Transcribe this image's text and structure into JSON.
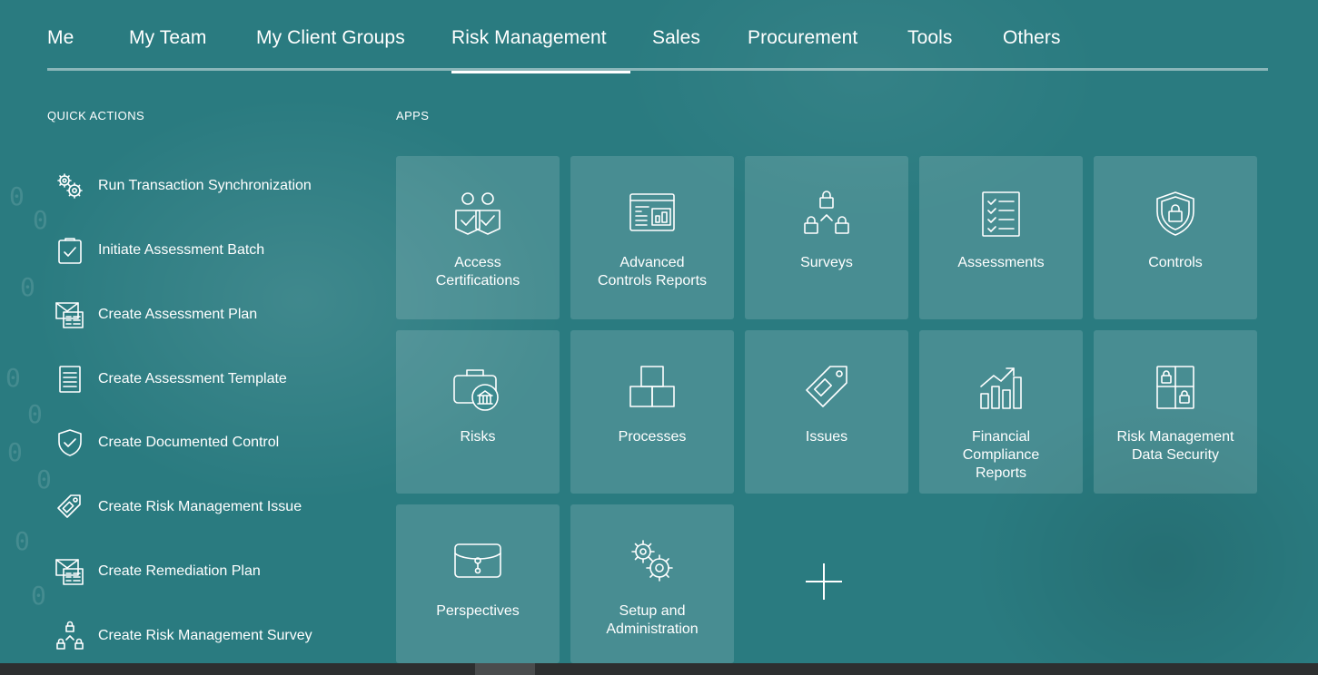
{
  "nav": {
    "tabs": [
      {
        "label": "Me"
      },
      {
        "label": "My Team"
      },
      {
        "label": "My Client Groups"
      },
      {
        "label": "Risk Management",
        "active": true
      },
      {
        "label": "Sales"
      },
      {
        "label": "Procurement"
      },
      {
        "label": "Tools"
      },
      {
        "label": "Others"
      }
    ]
  },
  "quick_actions": {
    "heading": "QUICK ACTIONS",
    "items": [
      {
        "label": "Run Transaction Synchronization",
        "icon": "gears-icon"
      },
      {
        "label": "Initiate Assessment Batch",
        "icon": "clipboard-check-icon"
      },
      {
        "label": "Create Assessment Plan",
        "icon": "envelope-form-icon"
      },
      {
        "label": "Create Assessment Template",
        "icon": "document-lines-icon"
      },
      {
        "label": "Create Documented Control",
        "icon": "shield-check-icon"
      },
      {
        "label": "Create Risk Management Issue",
        "icon": "tag-icon"
      },
      {
        "label": "Create Remediation Plan",
        "icon": "envelope-form-icon"
      },
      {
        "label": "Create Risk Management Survey",
        "icon": "lock-hierarchy-icon"
      }
    ]
  },
  "apps": {
    "heading": "APPS",
    "tiles": [
      {
        "label_lines": [
          "Access",
          "Certifications"
        ],
        "icon": "people-check-icon"
      },
      {
        "label_lines": [
          "Advanced",
          "Controls Reports"
        ],
        "icon": "report-dashboard-icon"
      },
      {
        "label_lines": [
          "Surveys"
        ],
        "icon": "lock-hierarchy-icon"
      },
      {
        "label_lines": [
          "Assessments"
        ],
        "icon": "checklist-icon"
      },
      {
        "label_lines": [
          "Controls"
        ],
        "icon": "shield-lock-icon"
      },
      {
        "label_lines": [
          "Risks"
        ],
        "icon": "briefcase-bank-icon"
      },
      {
        "label_lines": [
          "Processes"
        ],
        "icon": "boxes-icon"
      },
      {
        "label_lines": [
          "Issues"
        ],
        "icon": "tag-icon"
      },
      {
        "label_lines": [
          "Financial",
          "Compliance",
          "Reports"
        ],
        "icon": "growth-chart-icon"
      },
      {
        "label_lines": [
          "Risk Management",
          "Data Security"
        ],
        "icon": "lock-grid-icon"
      },
      {
        "label_lines": [
          "Perspectives"
        ],
        "icon": "briefcase-icon"
      },
      {
        "label_lines": [
          "Setup and",
          "Administration"
        ],
        "icon": "gears-icon"
      }
    ],
    "add_icon": "plus-icon"
  },
  "colors": {
    "background": "#2a7b80",
    "tile": "rgba(255,255,255,0.14)",
    "text": "#ffffff"
  }
}
